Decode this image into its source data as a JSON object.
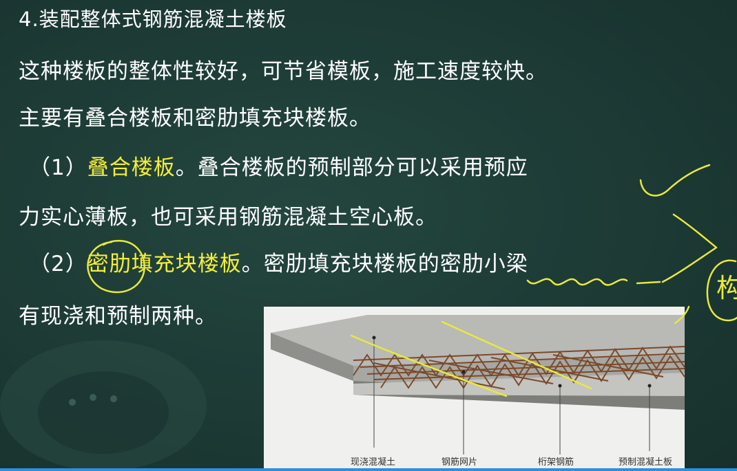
{
  "slide": {
    "title": "4.装配整体式钢筋混凝土楼板",
    "line1": "这种楼板的整体性较好，可节省模板，施工速度较快。",
    "line2": "主要有叠合楼板和密肋填充块楼板。",
    "line3": {
      "prefix": "（1）",
      "highlight": "叠合楼板",
      "rest": "。叠合楼板的预制部分可以采用预应"
    },
    "line4": "力实心薄板，也可采用钢筋混凝土空心板。",
    "line5": {
      "prefix": "（2）",
      "highlight": "密肋填充块楼板",
      "rest": "。密肋填充块楼板的密肋小梁"
    },
    "line6": "有现浇和预制两种。"
  },
  "figure": {
    "captions": [
      "现浇混凝土",
      "钢筋网片",
      "桁架钢筋",
      "预制混凝土板"
    ]
  },
  "annotation": {
    "handwritten_char": "构"
  },
  "colors": {
    "background": "#1f3d38",
    "text": "#ffffff",
    "highlight": "#f5ee3a",
    "ink": "#e8ea3a"
  }
}
